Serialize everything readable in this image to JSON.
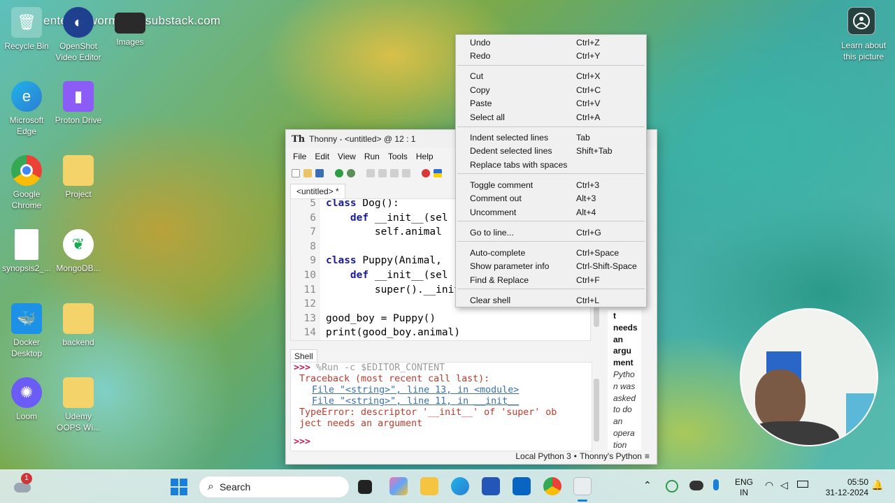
{
  "watermark": "enterthewormhol3.substack.com",
  "desktop_icons": [
    {
      "label": "Recycle Bin"
    },
    {
      "label": "OpenShot Video Editor"
    },
    {
      "label": "Images"
    },
    {
      "label": "Microsoft Edge"
    },
    {
      "label": "Proton Drive"
    },
    {
      "label": "Google Chrome"
    },
    {
      "label": "Project"
    },
    {
      "label": "synopsis2_..."
    },
    {
      "label": "MongoDB..."
    },
    {
      "label": "Docker Desktop"
    },
    {
      "label": "backend"
    },
    {
      "label": "Loom"
    },
    {
      "label": "Udemy OOPS Wi..."
    }
  ],
  "about_picture": "Learn about this picture",
  "thonny": {
    "title": "Thonny  -  <untitled>  @  12 : 1",
    "logo": "Th",
    "menu": [
      "File",
      "Edit",
      "View",
      "Run",
      "Tools",
      "Help"
    ],
    "tab": "<untitled> *",
    "editor_lines": [
      {
        "n": "5",
        "text": "class Dog():"
      },
      {
        "n": "6",
        "text": "    def __init__(sel"
      },
      {
        "n": "7",
        "text": "        self.animal"
      },
      {
        "n": "8",
        "text": ""
      },
      {
        "n": "9",
        "text": "class Puppy(Animal,"
      },
      {
        "n": "10",
        "text": "    def __init__(sel"
      },
      {
        "n": "11",
        "text": "        super().__init"
      },
      {
        "n": "12",
        "text": ""
      },
      {
        "n": "13",
        "text": "good_boy = Puppy()"
      },
      {
        "n": "14",
        "text": "print(good_boy.animal)"
      }
    ],
    "shell_label": "Shell",
    "shell": {
      "prompt": ">>>",
      "run_cmd": "%Run -c $EDITOR_CONTENT",
      "traceback": "Traceback (most recent call last):",
      "file1": "File \"<string>\", line 13, in <module>",
      "file2": "File \"<string>\", line 11, in __init__",
      "error1": "TypeError: descriptor '__init__' of 'super' ob",
      "error2": "ject needs an argument",
      "prompt2": ">>>"
    },
    "assistant": [
      "t",
      "needs",
      "an",
      "argu",
      "ment",
      "Pytho",
      "n was",
      "asked",
      "to do",
      "an",
      "opera",
      "tion"
    ],
    "status_interpreter": "Local Python 3",
    "status_sep": "•",
    "status_app": "Thonny's Python",
    "status_menu": "≡"
  },
  "context_menu": [
    {
      "label": "Undo",
      "shortcut": "Ctrl+Z"
    },
    {
      "label": "Redo",
      "shortcut": "Ctrl+Y"
    },
    {
      "label": "Cut",
      "shortcut": "Ctrl+X"
    },
    {
      "label": "Copy",
      "shortcut": "Ctrl+C"
    },
    {
      "label": "Paste",
      "shortcut": "Ctrl+V"
    },
    {
      "label": "Select all",
      "shortcut": "Ctrl+A"
    },
    {
      "label": "Indent selected lines",
      "shortcut": "Tab"
    },
    {
      "label": "Dedent selected lines",
      "shortcut": "Shift+Tab"
    },
    {
      "label": "Replace tabs with spaces",
      "shortcut": ""
    },
    {
      "label": "Toggle comment",
      "shortcut": "Ctrl+3"
    },
    {
      "label": "Comment out",
      "shortcut": "Alt+3"
    },
    {
      "label": "Uncomment",
      "shortcut": "Alt+4"
    },
    {
      "label": "Go to line...",
      "shortcut": "Ctrl+G"
    },
    {
      "label": "Auto-complete",
      "shortcut": "Ctrl+Space"
    },
    {
      "label": "Show parameter info",
      "shortcut": "Ctrl-Shift-Space"
    },
    {
      "label": "Find & Replace",
      "shortcut": "Ctrl+F"
    },
    {
      "label": "Clear shell",
      "shortcut": "Ctrl+L"
    }
  ],
  "taskbar": {
    "weather_badge": "1",
    "search_placeholder": "Search",
    "lang_top": "ENG",
    "lang_bottom": "IN",
    "time": "05:50",
    "date": "31-12-2024"
  },
  "colors": {
    "accent": "#c02050",
    "link": "#3a6fb5",
    "error": "#c0392b"
  }
}
